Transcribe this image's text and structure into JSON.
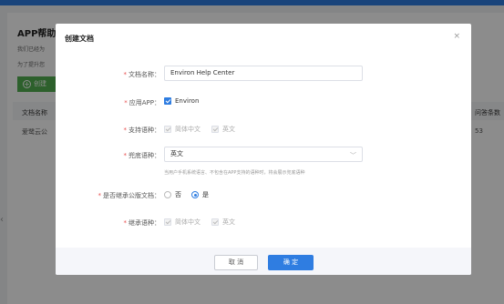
{
  "background": {
    "title": "APP帮助",
    "line1": "我们已经为",
    "line2": "为了提升您",
    "create_button": "创建",
    "col_doc_name": "文档名称",
    "col_feedback": "问答条数",
    "row_name": "爱鹭云公",
    "row_count": "53"
  },
  "modal": {
    "title": "创建文档",
    "close": "×",
    "doc_name_label": "文档名称：",
    "doc_name_value": "Environ Help Center",
    "app_label": "应用APP：",
    "app_value": "Environ",
    "lang_label": "支持语种：",
    "lang_opt1": "简体中文",
    "lang_opt2": "英文",
    "fallback_label": "兜底语种：",
    "fallback_value": "英文",
    "fallback_hint": "当用户手机系统语言、不包含在APP支持的语种时，将会展示兜底语种",
    "inherit_label": "是否继承公版文档：",
    "inherit_no": "否",
    "inherit_yes": "是",
    "inherit_lang_label": "继承语种：",
    "inherit_opt1": "简体中文",
    "inherit_opt2": "英文",
    "cancel": "取 消",
    "ok": "确 定"
  },
  "colors": {
    "accent": "#2f7de1",
    "green": "#52b050",
    "required": "#e84e4e"
  },
  "icons": {
    "close": "close-icon",
    "chevron": "chevron-down-icon",
    "plus": "plus-circle-icon"
  }
}
